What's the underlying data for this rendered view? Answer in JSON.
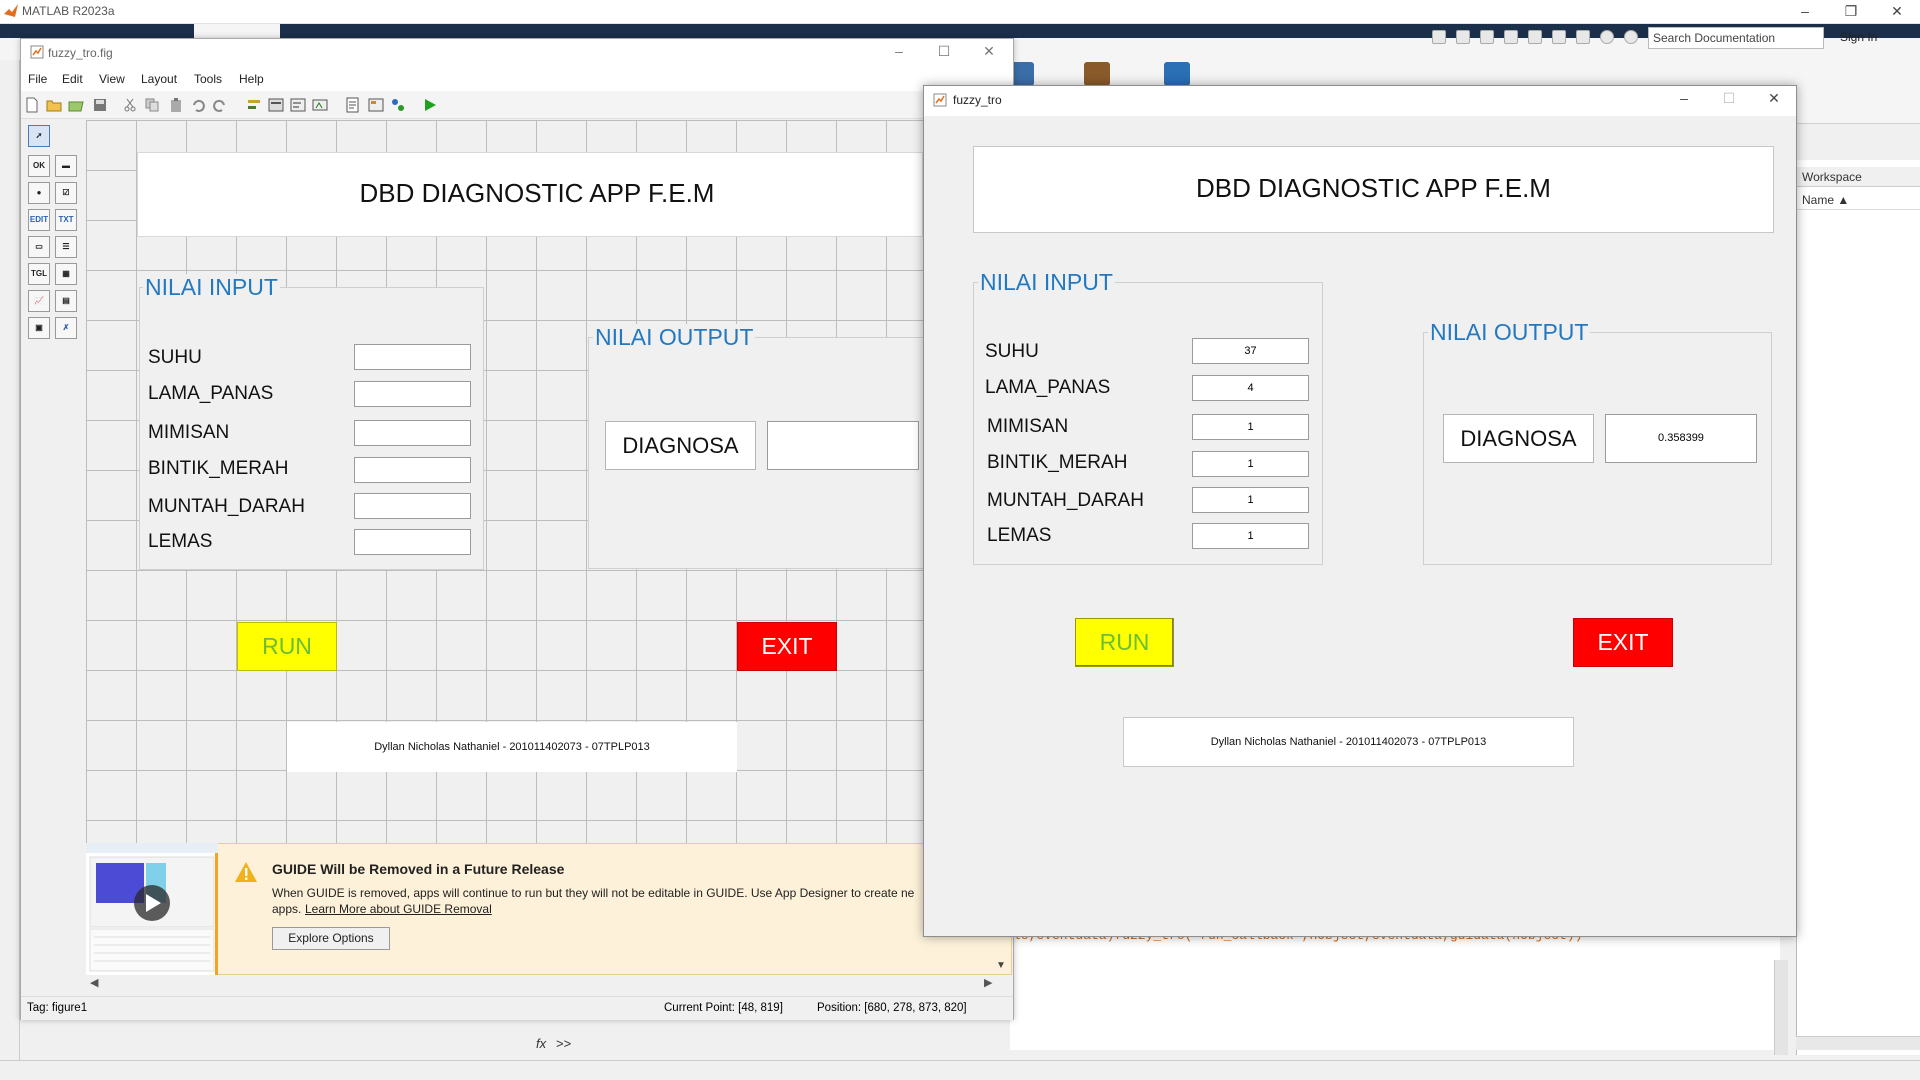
{
  "matlab": {
    "title": "MATLAB R2023a",
    "search_placeholder": "Search Documentation",
    "sign_in": "Sign In",
    "workspace_title": "Workspace",
    "workspace_column": "Name ▲",
    "command_line": "le,eventdata)fuzzy_tro('run_callback',hObject,eventdata,guidata(hObject))",
    "prompt": ">>",
    "fx": "fx"
  },
  "guide": {
    "window_title": "fuzzy_tro.fig",
    "menu": [
      "File",
      "Edit",
      "View",
      "Layout",
      "Tools",
      "Help"
    ],
    "app_title": "DBD DIAGNOSTIC APP F.E.M",
    "input_panel_title": "NILAI INPUT",
    "output_panel_title": "NILAI OUTPUT",
    "inputs": [
      "SUHU",
      "LAMA_PANAS",
      "MIMISAN",
      "BINTIK_MERAH",
      "MUNTAH_DARAH",
      "LEMAS"
    ],
    "diagnosa_label": "DIAGNOSA",
    "run_label": "RUN",
    "exit_label": "EXIT",
    "credit": "Dyllan Nicholas Nathaniel - 201011402073 - 07TPLP013",
    "notification": {
      "title": "GUIDE Will be Removed in a Future Release",
      "text1": "When GUIDE is removed, apps will continue to run but they will not be editable in GUIDE. Use App Designer to create ne",
      "text2_prefix": "apps.",
      "link": "Learn More about GUIDE Removal",
      "button": "Explore Options"
    },
    "status": {
      "tag": "Tag: figure1",
      "current_point": "Current Point:  [48, 819]",
      "position": "Position: [680, 278, 873, 820]"
    }
  },
  "figure": {
    "window_title": "fuzzy_tro",
    "app_title": "DBD DIAGNOSTIC APP F.E.M",
    "input_panel_title": "NILAI INPUT",
    "output_panel_title": "NILAI OUTPUT",
    "inputs": [
      {
        "label": "SUHU",
        "value": "37"
      },
      {
        "label": "LAMA_PANAS",
        "value": "4"
      },
      {
        "label": "MIMISAN",
        "value": "1"
      },
      {
        "label": "BINTIK_MERAH",
        "value": "1"
      },
      {
        "label": "MUNTAH_DARAH",
        "value": "1"
      },
      {
        "label": "LEMAS",
        "value": "1"
      }
    ],
    "diagnosa_label": "DIAGNOSA",
    "diagnosa_value": "0.358399",
    "run_label": "RUN",
    "exit_label": "EXIT",
    "credit": "Dyllan Nicholas Nathaniel - 201011402073 - 07TPLP013"
  },
  "colors": {
    "panel_title": "#2379c1",
    "run_bg": "#ffff00",
    "run_text": "#6bbf34",
    "exit_bg": "#ff0000",
    "exit_text": "#ffffff"
  }
}
